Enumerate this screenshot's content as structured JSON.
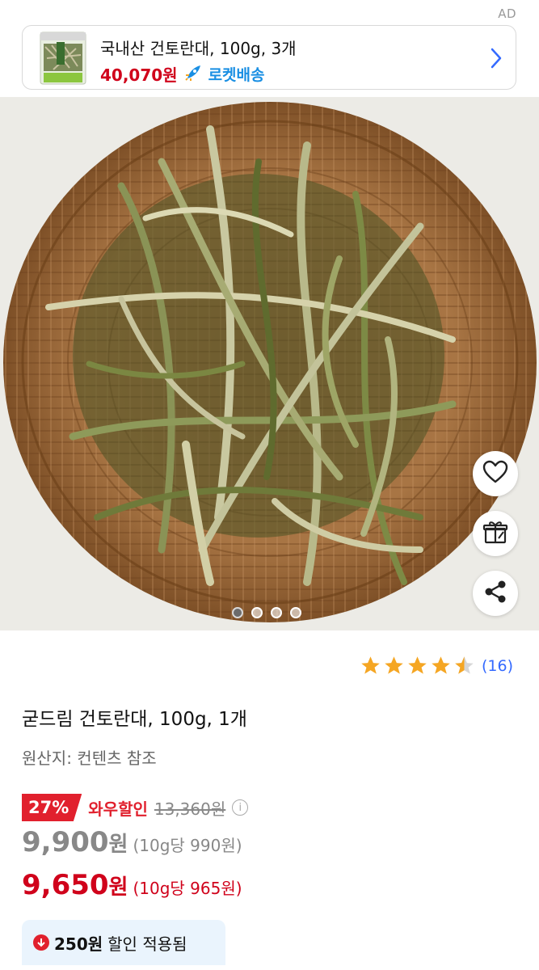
{
  "ad": {
    "label": "AD",
    "title": "국내산 건토란대, 100g, 3개",
    "price": "40,070원",
    "delivery": "로켓배송",
    "thumb_icon": "product-package-thumbnail",
    "chevron_icon": "chevron-right-icon",
    "colors": {
      "price": "#d0021b",
      "rocket": "#1a8fe3"
    }
  },
  "gallery": {
    "image_icon": "dried-taro-stems-in-wicker-basket",
    "page_count": 4,
    "current_page": 1
  },
  "actions": {
    "wishlist_icon": "heart-icon",
    "gift_icon": "gift-icon",
    "share_icon": "share-icon"
  },
  "rating": {
    "stars": 4.5,
    "count": "(16)"
  },
  "product": {
    "title": "굳드림 건토란대, 100g, 1개",
    "origin": "원산지: 컨텐츠 참조"
  },
  "pricing": {
    "discount_pct": "27%",
    "discount_label": "와우할인",
    "original_price": "13,360원",
    "sale_price": "9,900",
    "sale_unit_price": "(10g당 990원)",
    "final_price": "9,650",
    "final_unit_price": "(10g당 965원)",
    "won": "원",
    "applied_amount": "250원",
    "applied_text": "할인 적용됨",
    "colors": {
      "accent": "#e1202d",
      "final": "#d0021b"
    }
  }
}
